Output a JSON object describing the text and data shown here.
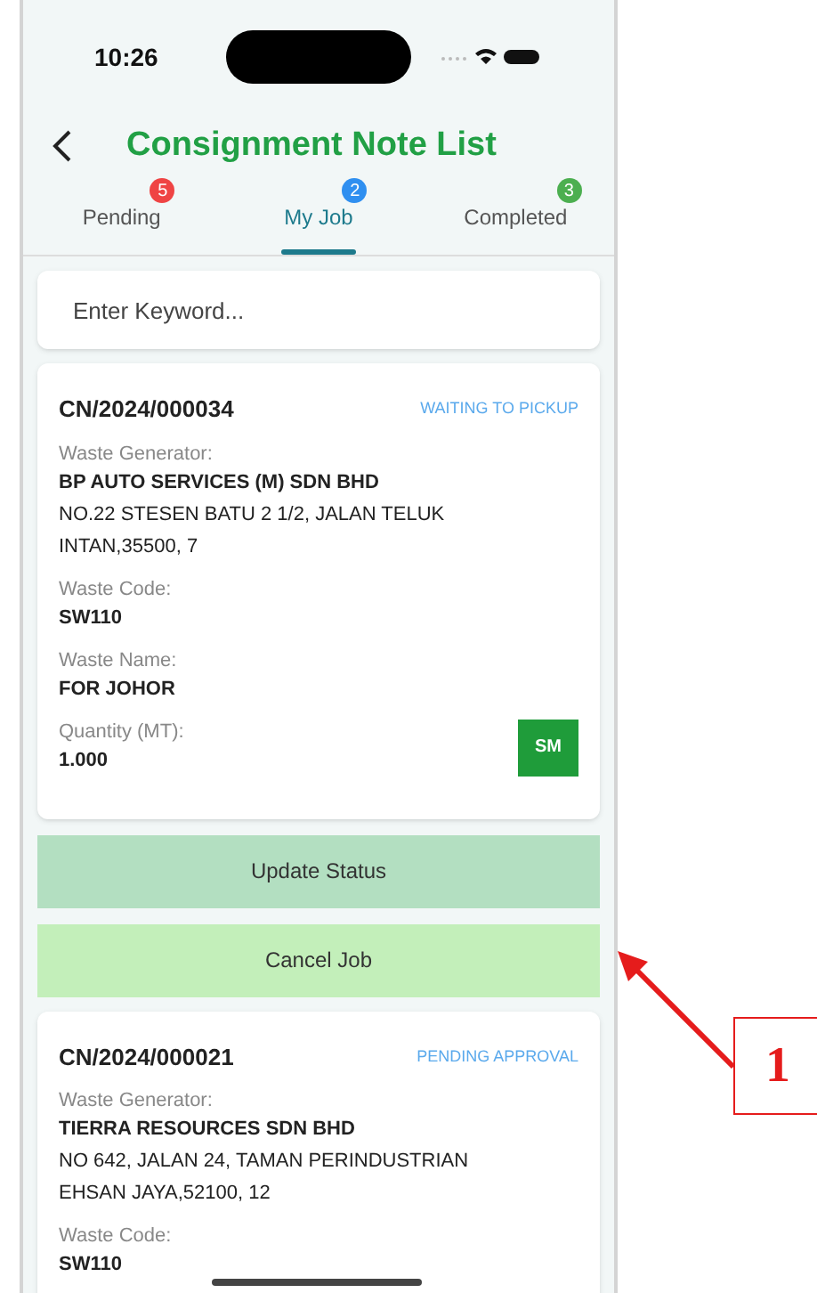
{
  "status_bar": {
    "time": "10:26"
  },
  "header": {
    "title": "Consignment Note List"
  },
  "tabs": [
    {
      "label": "Pending",
      "count": "5",
      "color": "#ef4444",
      "selected": false
    },
    {
      "label": "My Job",
      "count": "2",
      "color": "#2f8ff0",
      "selected": true
    },
    {
      "label": "Completed",
      "count": "3",
      "color": "#4caf50",
      "selected": false
    }
  ],
  "search": {
    "placeholder": "Enter Keyword..."
  },
  "cards": [
    {
      "number": "CN/2024/000034",
      "status": "WAITING TO PICKUP",
      "fields": [
        {
          "label": "Waste Generator:",
          "value": "BP AUTO SERVICES (M) SDN BHD",
          "address": "NO.22 STESEN BATU 2 1/2, JALAN TELUK INTAN,35500, 7"
        },
        {
          "label": "Waste Code:",
          "value": "SW110"
        },
        {
          "label": "Waste Name:",
          "value": "FOR JOHOR"
        },
        {
          "label": "Quantity (MT):",
          "value": "1.000"
        }
      ],
      "badge": "SM",
      "actions": [
        {
          "label": "Update Status",
          "kind": "update"
        },
        {
          "label": "Cancel Job",
          "kind": "cancel"
        }
      ]
    },
    {
      "number": "CN/2024/000021",
      "status": "PENDING APPROVAL",
      "fields": [
        {
          "label": "Waste Generator:",
          "value": "TIERRA RESOURCES SDN BHD",
          "address": "NO 642, JALAN 24, TAMAN PERINDUSTRIAN EHSAN JAYA,52100, 12"
        },
        {
          "label": "Waste Code:",
          "value": "SW110"
        }
      ]
    }
  ],
  "annotation": {
    "label": "1"
  }
}
